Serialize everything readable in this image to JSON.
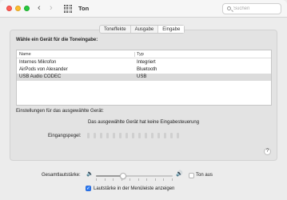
{
  "window": {
    "title": "Ton"
  },
  "search": {
    "placeholder": "Suchen",
    "value": ""
  },
  "tabs": [
    {
      "label": "Toneffekte",
      "active": false
    },
    {
      "label": "Ausgabe",
      "active": false
    },
    {
      "label": "Eingabe",
      "active": true
    }
  ],
  "input": {
    "heading": "Wähle ein Gerät für die Toneingabe:",
    "columns": [
      "Name",
      "Typ"
    ],
    "devices": [
      {
        "name": "Internes Mikrofon",
        "type": "Integriert",
        "selected": false
      },
      {
        "name": "AirPods von Alexander",
        "type": "Bluetooth",
        "selected": false
      },
      {
        "name": "USB Audio CODEC",
        "type": "USB",
        "selected": true
      }
    ],
    "settings_label": "Einstellungen für das ausgewählte Gerät:",
    "no_input_control": "Das ausgewählte Gerät hat keine Eingabesteuerung",
    "level_label": "Eingangspegel:",
    "level_bars": 15,
    "level_active": 0
  },
  "help_label": "?",
  "volume": {
    "label": "Gesamtlautstärke:",
    "level": 0.35,
    "mute_label": "Ton aus",
    "mute_checked": false,
    "menubar_label": "Lautstärke in der Menüleiste anzeigen",
    "menubar_checked": true
  },
  "colors": {
    "accent": "#2f7ef5",
    "selection": "#dcdcdc"
  },
  "icons": [
    "back-icon",
    "forward-icon",
    "grid-icon",
    "search-icon",
    "speaker-low-icon",
    "speaker-high-icon",
    "help-icon"
  ]
}
